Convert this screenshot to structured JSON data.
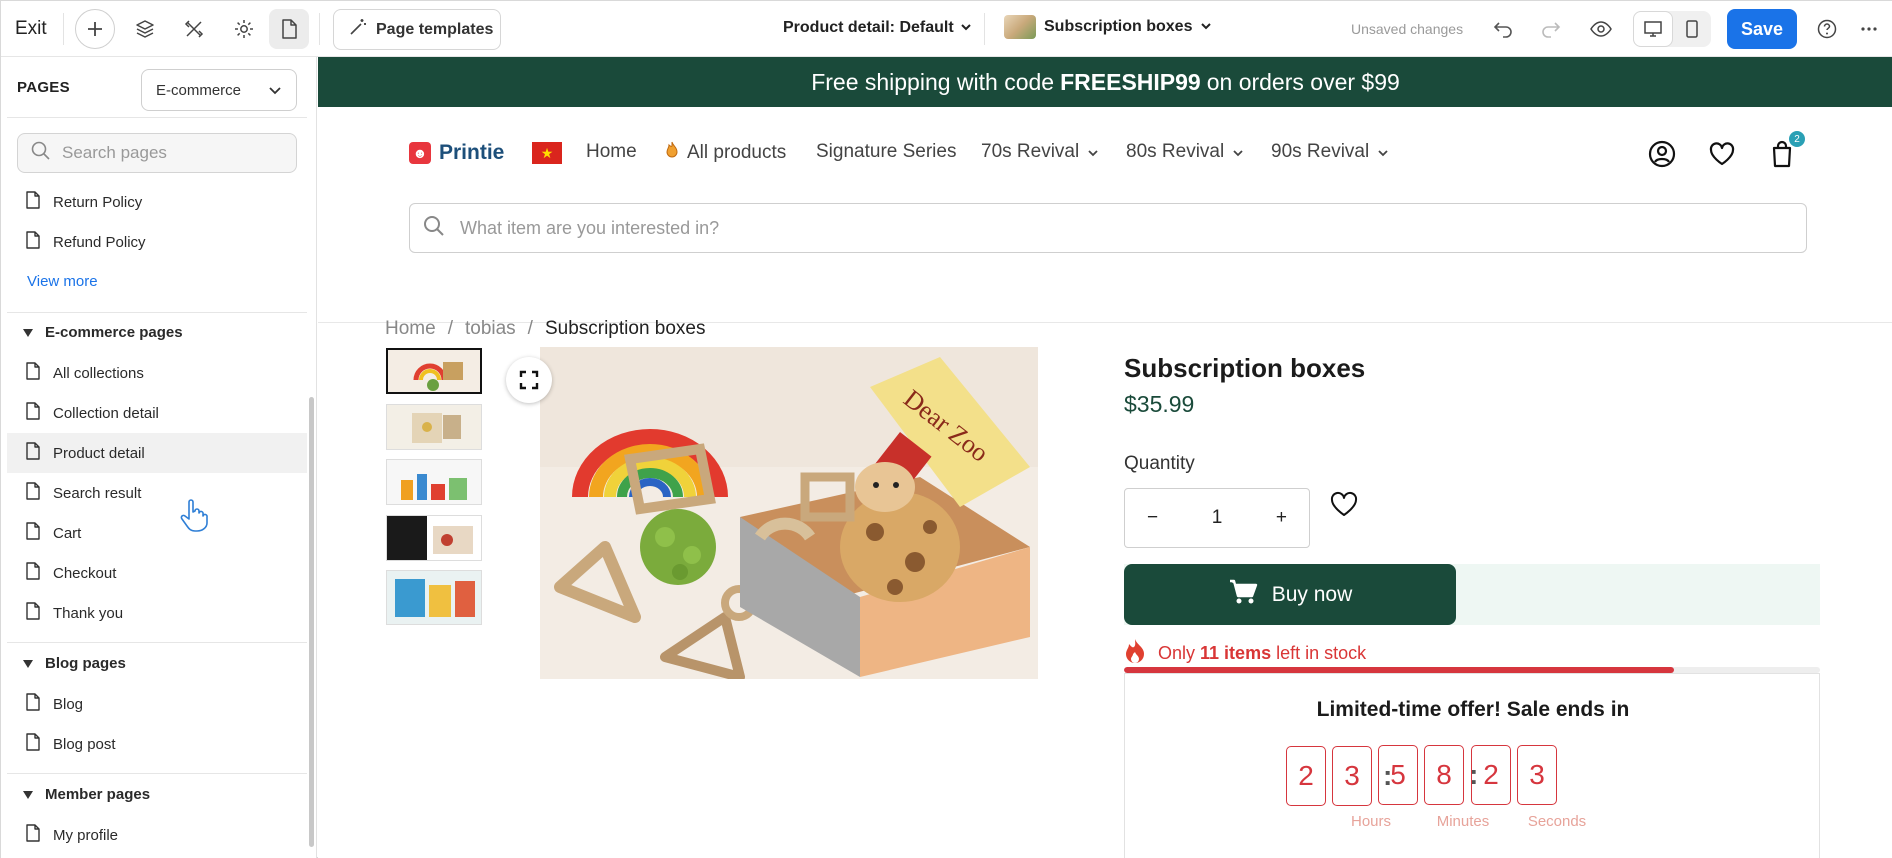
{
  "toolbar": {
    "exit_label": "Exit",
    "page_templates_label": "Page templates",
    "page_selector": "Product detail: Default",
    "product_selector": "Subscription boxes",
    "status_text": "Unsaved changes",
    "save_label": "Save"
  },
  "sidebar": {
    "title": "PAGES",
    "site_select": "E-commerce",
    "search_placeholder": "Search pages",
    "general_items": [
      "Return Policy",
      "Refund Policy"
    ],
    "view_more": "View more",
    "ecommerce_section": "E-commerce pages",
    "ecommerce_items": [
      "All collections",
      "Collection detail",
      "Product detail",
      "Search result",
      "Cart",
      "Checkout",
      "Thank you"
    ],
    "blog_section": "Blog pages",
    "blog_items": [
      "Blog",
      "Blog post"
    ],
    "member_section": "Member pages",
    "member_items": [
      "My profile"
    ]
  },
  "store": {
    "announcement_pre": "Free shipping with code",
    "announcement_code": "FREESHIP99",
    "announcement_post": "on orders over $99",
    "logo_text": "Printie",
    "menu": [
      "Home",
      "All products",
      "Signature Series",
      "70s Revival",
      "80s Revival",
      "90s Revival"
    ],
    "cart_count": "2",
    "search_placeholder": "What item are you interested in?"
  },
  "breadcrumb": [
    "Home",
    "tobias",
    "Subscription boxes"
  ],
  "product": {
    "title": "Subscription boxes",
    "price": "$35.99",
    "quantity_label": "Quantity",
    "quantity": "1",
    "buy_label": "Buy now",
    "stock_pre": "Only",
    "stock_count": "11 items",
    "stock_post": "left in stock",
    "stock_level": 0.79,
    "offer_title": "Limited-time offer! Sale ends in",
    "countdown": {
      "hours": [
        "2",
        "3"
      ],
      "minutes": [
        "5",
        "8"
      ],
      "seconds": [
        "2",
        "3"
      ],
      "labels": [
        "Hours",
        "Minutes",
        "Seconds"
      ]
    }
  },
  "colors": {
    "brand_green": "#1a4a3a",
    "accent_blue": "#1a73e8",
    "alert_red": "#d6363e"
  }
}
